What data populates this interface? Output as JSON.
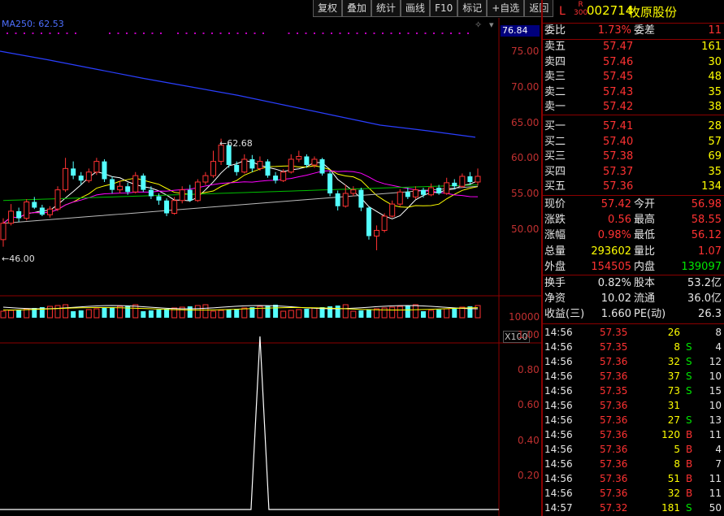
{
  "toolbar": [
    "复权",
    "叠加",
    "统计",
    "画线",
    "F10",
    "标记",
    "+自选",
    "返回"
  ],
  "chart": {
    "ma_label": "MA250: 62.53",
    "price_box": "76.84",
    "y_ticks": [
      "75.00",
      "70.00",
      "65.00",
      "60.00",
      "55.00",
      "50.00"
    ],
    "high_marker": "62.68",
    "low_marker": "46.00",
    "vol_tick": "10000",
    "vol_unit": "X100",
    "ind_ticks": [
      "1.00",
      "0.80",
      "0.60",
      "0.40",
      "0.20"
    ]
  },
  "header": {
    "flag": "L",
    "r_label": "R",
    "r_num": "300",
    "code": "002714",
    "name": "牧原股份"
  },
  "weibi": {
    "label": "委比",
    "value": "1.73%",
    "label2": "委差",
    "value2": "11"
  },
  "asks": [
    {
      "label": "卖五",
      "price": "57.47",
      "vol": "161"
    },
    {
      "label": "卖四",
      "price": "57.46",
      "vol": "30"
    },
    {
      "label": "卖三",
      "price": "57.45",
      "vol": "48"
    },
    {
      "label": "卖二",
      "price": "57.43",
      "vol": "35"
    },
    {
      "label": "卖一",
      "price": "57.42",
      "vol": "38"
    }
  ],
  "bids": [
    {
      "label": "买一",
      "price": "57.41",
      "vol": "28"
    },
    {
      "label": "买二",
      "price": "57.40",
      "vol": "57"
    },
    {
      "label": "买三",
      "price": "57.38",
      "vol": "69"
    },
    {
      "label": "买四",
      "price": "57.37",
      "vol": "35"
    },
    {
      "label": "买五",
      "price": "57.36",
      "vol": "134"
    }
  ],
  "quote": [
    {
      "l1": "现价",
      "v1": "57.42",
      "l2": "今开",
      "v2": "56.98",
      "c2": "red"
    },
    {
      "l1": "涨跌",
      "v1": "0.56",
      "l2": "最高",
      "v2": "58.55",
      "c2": "red"
    },
    {
      "l1": "涨幅",
      "v1": "0.98%",
      "l2": "最低",
      "v2": "56.12",
      "c2": "red"
    },
    {
      "l1": "总量",
      "v1": "293602",
      "l2": "量比",
      "v2": "1.07",
      "c2": "red"
    },
    {
      "l1": "外盘",
      "v1": "154505",
      "l2": "内盘",
      "v2": "139097",
      "c2": "green"
    }
  ],
  "fund": [
    {
      "l1": "换手",
      "v1": "0.82%",
      "l2": "股本",
      "v2": "53.2亿"
    },
    {
      "l1": "净资",
      "v1": "10.02",
      "l2": "流通",
      "v2": "36.0亿"
    },
    {
      "l1": "收益(三)",
      "v1": "1.660",
      "l2": "PE(动)",
      "v2": "26.3"
    }
  ],
  "ticks": [
    {
      "time": "14:56",
      "price": "57.35",
      "vol": "26",
      "side": "",
      "n": "8"
    },
    {
      "time": "14:56",
      "price": "57.35",
      "vol": "8",
      "side": "S",
      "n": "4"
    },
    {
      "time": "14:56",
      "price": "57.36",
      "vol": "32",
      "side": "S",
      "n": "12"
    },
    {
      "time": "14:56",
      "price": "57.36",
      "vol": "37",
      "side": "S",
      "n": "10"
    },
    {
      "time": "14:56",
      "price": "57.35",
      "vol": "73",
      "side": "S",
      "n": "15"
    },
    {
      "time": "14:56",
      "price": "57.36",
      "vol": "31",
      "side": "",
      "n": "10"
    },
    {
      "time": "14:56",
      "price": "57.36",
      "vol": "27",
      "side": "S",
      "n": "13"
    },
    {
      "time": "14:56",
      "price": "57.36",
      "vol": "120",
      "side": "B",
      "n": "11"
    },
    {
      "time": "14:56",
      "price": "57.36",
      "vol": "5",
      "side": "B",
      "n": "4"
    },
    {
      "time": "14:56",
      "price": "57.36",
      "vol": "8",
      "side": "B",
      "n": "7"
    },
    {
      "time": "14:56",
      "price": "57.36",
      "vol": "51",
      "side": "B",
      "n": "11"
    },
    {
      "time": "14:56",
      "price": "57.36",
      "vol": "32",
      "side": "B",
      "n": "11"
    },
    {
      "time": "14:57",
      "price": "57.32",
      "vol": "181",
      "side": "S",
      "n": "50"
    }
  ],
  "candles": [
    {
      "o": 48.5,
      "c": 50.8,
      "h": 51.5,
      "l": 47.5
    },
    {
      "o": 50.8,
      "c": 52.5,
      "h": 53.5,
      "l": 50.5
    },
    {
      "o": 52.5,
      "c": 51.5,
      "h": 53.0,
      "l": 51.0
    },
    {
      "o": 51.5,
      "c": 53.8,
      "h": 54.2,
      "l": 51.2
    },
    {
      "o": 53.8,
      "c": 53.0,
      "h": 54.5,
      "l": 52.8
    },
    {
      "o": 53.0,
      "c": 52.0,
      "h": 53.4,
      "l": 51.8
    },
    {
      "o": 52.0,
      "c": 52.8,
      "h": 53.2,
      "l": 51.6
    },
    {
      "o": 52.8,
      "c": 55.5,
      "h": 56.0,
      "l": 52.5
    },
    {
      "o": 55.5,
      "c": 58.5,
      "h": 60.0,
      "l": 55.2
    },
    {
      "o": 58.5,
      "c": 57.5,
      "h": 59.5,
      "l": 57.0
    },
    {
      "o": 57.5,
      "c": 56.8,
      "h": 58.0,
      "l": 56.2
    },
    {
      "o": 56.8,
      "c": 58.0,
      "h": 58.5,
      "l": 56.5
    },
    {
      "o": 58.0,
      "c": 59.5,
      "h": 60.0,
      "l": 57.6
    },
    {
      "o": 59.5,
      "c": 57.0,
      "h": 59.8,
      "l": 56.6
    },
    {
      "o": 57.0,
      "c": 55.5,
      "h": 57.4,
      "l": 55.0
    },
    {
      "o": 55.5,
      "c": 56.0,
      "h": 56.8,
      "l": 55.0
    },
    {
      "o": 56.0,
      "c": 55.2,
      "h": 56.5,
      "l": 54.8
    },
    {
      "o": 55.2,
      "c": 57.5,
      "h": 58.0,
      "l": 55.0
    },
    {
      "o": 57.5,
      "c": 55.5,
      "h": 57.8,
      "l": 55.2
    },
    {
      "o": 55.5,
      "c": 54.6,
      "h": 56.0,
      "l": 54.2
    },
    {
      "o": 54.6,
      "c": 54.0,
      "h": 55.0,
      "l": 53.4
    },
    {
      "o": 54.0,
      "c": 52.2,
      "h": 54.3,
      "l": 51.8
    },
    {
      "o": 52.2,
      "c": 54.0,
      "h": 54.5,
      "l": 52.0
    },
    {
      "o": 54.0,
      "c": 55.5,
      "h": 56.0,
      "l": 53.6
    },
    {
      "o": 55.5,
      "c": 54.0,
      "h": 56.2,
      "l": 53.8
    },
    {
      "o": 54.0,
      "c": 56.6,
      "h": 57.0,
      "l": 53.8
    },
    {
      "o": 56.6,
      "c": 57.5,
      "h": 58.0,
      "l": 56.2
    },
    {
      "o": 57.5,
      "c": 59.5,
      "h": 61.0,
      "l": 57.2
    },
    {
      "o": 59.5,
      "c": 61.8,
      "h": 62.7,
      "l": 59.0
    },
    {
      "o": 61.8,
      "c": 59.0,
      "h": 62.0,
      "l": 58.6
    },
    {
      "o": 59.0,
      "c": 58.0,
      "h": 59.5,
      "l": 57.5
    },
    {
      "o": 58.0,
      "c": 59.8,
      "h": 60.5,
      "l": 57.8
    },
    {
      "o": 59.8,
      "c": 58.5,
      "h": 60.4,
      "l": 58.0
    },
    {
      "o": 58.5,
      "c": 59.5,
      "h": 60.2,
      "l": 58.2
    },
    {
      "o": 59.5,
      "c": 57.5,
      "h": 59.8,
      "l": 57.2
    },
    {
      "o": 57.5,
      "c": 56.8,
      "h": 58.0,
      "l": 56.4
    },
    {
      "o": 56.8,
      "c": 58.0,
      "h": 58.4,
      "l": 56.6
    },
    {
      "o": 58.0,
      "c": 59.8,
      "h": 60.5,
      "l": 57.8
    },
    {
      "o": 59.8,
      "c": 60.2,
      "h": 61.0,
      "l": 59.4
    },
    {
      "o": 60.2,
      "c": 59.0,
      "h": 60.5,
      "l": 58.6
    },
    {
      "o": 59.0,
      "c": 59.8,
      "h": 60.2,
      "l": 58.6
    },
    {
      "o": 59.8,
      "c": 57.8,
      "h": 60.0,
      "l": 57.5
    },
    {
      "o": 57.8,
      "c": 55.0,
      "h": 58.2,
      "l": 54.6
    },
    {
      "o": 55.0,
      "c": 53.2,
      "h": 55.4,
      "l": 52.6
    },
    {
      "o": 53.2,
      "c": 55.0,
      "h": 56.2,
      "l": 53.0
    },
    {
      "o": 55.0,
      "c": 55.5,
      "h": 56.0,
      "l": 54.6
    },
    {
      "o": 55.5,
      "c": 53.0,
      "h": 55.8,
      "l": 52.5
    },
    {
      "o": 53.0,
      "c": 49.0,
      "h": 53.2,
      "l": 48.5
    },
    {
      "o": 49.0,
      "c": 49.8,
      "h": 50.5,
      "l": 47.0
    },
    {
      "o": 49.8,
      "c": 51.8,
      "h": 52.2,
      "l": 49.5
    },
    {
      "o": 51.8,
      "c": 53.5,
      "h": 54.0,
      "l": 51.6
    },
    {
      "o": 53.5,
      "c": 55.2,
      "h": 55.6,
      "l": 53.2
    },
    {
      "o": 55.2,
      "c": 54.5,
      "h": 55.8,
      "l": 54.2
    },
    {
      "o": 54.5,
      "c": 55.5,
      "h": 56.0,
      "l": 54.2
    },
    {
      "o": 55.5,
      "c": 54.8,
      "h": 55.8,
      "l": 54.4
    },
    {
      "o": 54.8,
      "c": 55.8,
      "h": 56.4,
      "l": 54.6
    },
    {
      "o": 55.8,
      "c": 55.0,
      "h": 56.2,
      "l": 54.8
    },
    {
      "o": 55.0,
      "c": 56.5,
      "h": 57.2,
      "l": 54.8
    },
    {
      "o": 56.5,
      "c": 56.0,
      "h": 57.0,
      "l": 55.6
    },
    {
      "o": 56.0,
      "c": 57.4,
      "h": 57.8,
      "l": 55.8
    },
    {
      "o": 57.4,
      "c": 56.6,
      "h": 58.0,
      "l": 56.2
    },
    {
      "o": 56.6,
      "c": 57.4,
      "h": 58.5,
      "l": 56.1
    }
  ],
  "ma250": [
    75.0,
    73.8,
    72.5,
    71.2,
    70.0,
    68.8,
    67.4,
    66.0,
    64.6,
    63.8,
    62.9
  ],
  "ind_peak_index": 33
}
